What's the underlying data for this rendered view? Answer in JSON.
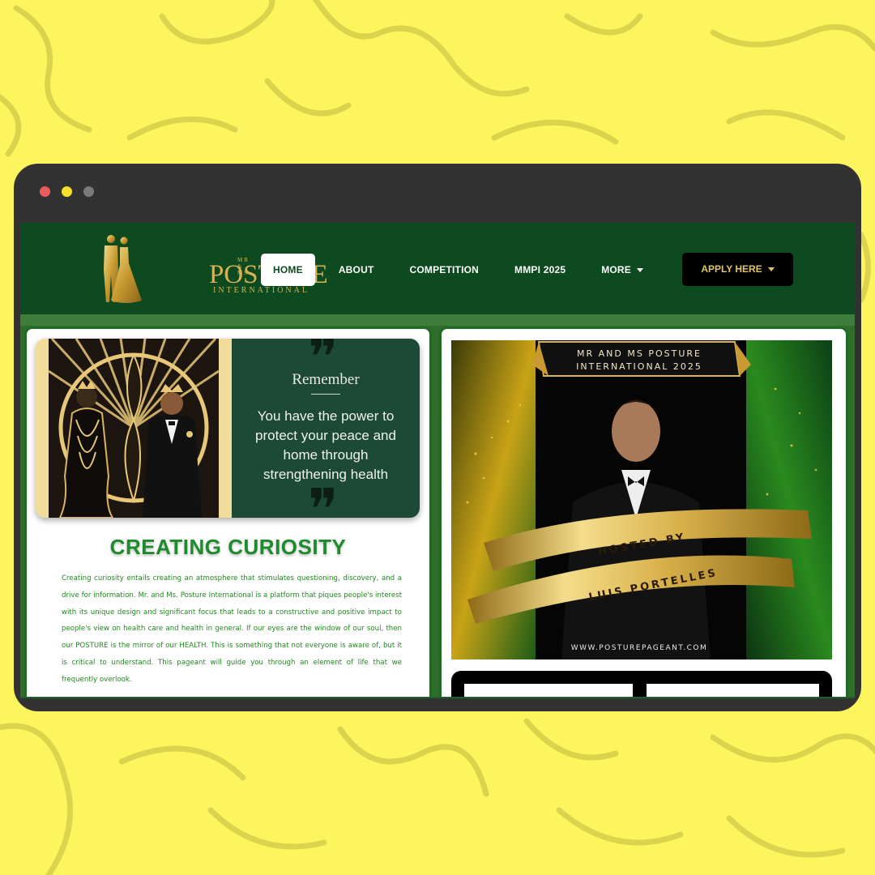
{
  "window": {
    "dot_colors": [
      "#ec5b5b",
      "#f7e12a",
      "#7a7a7a"
    ]
  },
  "nav": {
    "logo": {
      "small": "MR & MS",
      "main": "POSTURE",
      "sub": "INTERNATIONAL"
    },
    "items": [
      {
        "label": "HOME",
        "active": true
      },
      {
        "label": "ABOUT"
      },
      {
        "label": "COMPETITION"
      },
      {
        "label": "MMPI 2025"
      },
      {
        "label": "MORE"
      }
    ],
    "apply_label": "APPLY HERE"
  },
  "quote": {
    "title": "Remember",
    "text": "You have the power to protect your peace and home through strengthening health"
  },
  "article": {
    "heading": "CREATING CURIOSITY",
    "body": "Creating curiosity entails creating an atmosphere that stimulates questioning, discovery, and a drive for information.  Mr. and Ms. Posture International is a platform that piques people's interest with its unique design and significant focus that leads to a constructive and positive impact to people's view on health care and health in general. If our eyes are the window of our soul, then our POSTURE is the mirror of our HEALTH. This is something that not everyone is aware of, but it is critical to understand. This pageant will guide you through an element of life that we frequently overlook."
  },
  "poster": {
    "banner_line1": "MR AND MS POSTURE",
    "banner_line2": "INTERNATIONAL 2025",
    "ribbon_line1": "HOSTED BY",
    "ribbon_line2": "LUIS  PORTELLES",
    "website": "WWW.POSTUREPAGEANT.COM"
  },
  "colors": {
    "background": "#fdf55e",
    "nav_green": "#0d4a1f",
    "heading_green": "#1d8a2b",
    "gold": "#d7b356"
  }
}
